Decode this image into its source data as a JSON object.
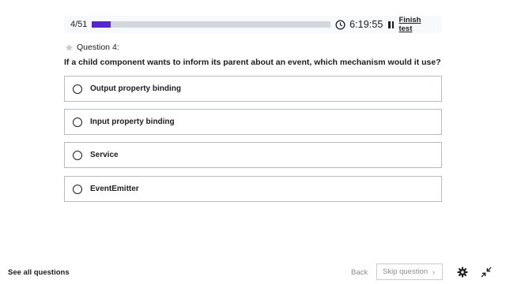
{
  "progress": {
    "counter": "4/51",
    "fraction": 0.0784,
    "accent_color": "#5624d0"
  },
  "timer": {
    "icon": "clock-icon",
    "time": "6:19:55",
    "pause_icon": "pause-icon"
  },
  "finish_label": "Finish test",
  "question": {
    "star_icon": "star-icon",
    "number_label": "Question 4:",
    "text": "If a child component wants to inform its parent about an event, which mechanism would it use?"
  },
  "options": [
    {
      "label": "Output property binding"
    },
    {
      "label": "Input property binding"
    },
    {
      "label": "Service"
    },
    {
      "label": "EventEmitter"
    }
  ],
  "footer": {
    "see_all": "See all questions",
    "back": "Back",
    "skip": "Skip question",
    "skip_chevron": "›",
    "settings_icon": "gear-icon",
    "fullscreen_icon": "collapse-icon"
  }
}
